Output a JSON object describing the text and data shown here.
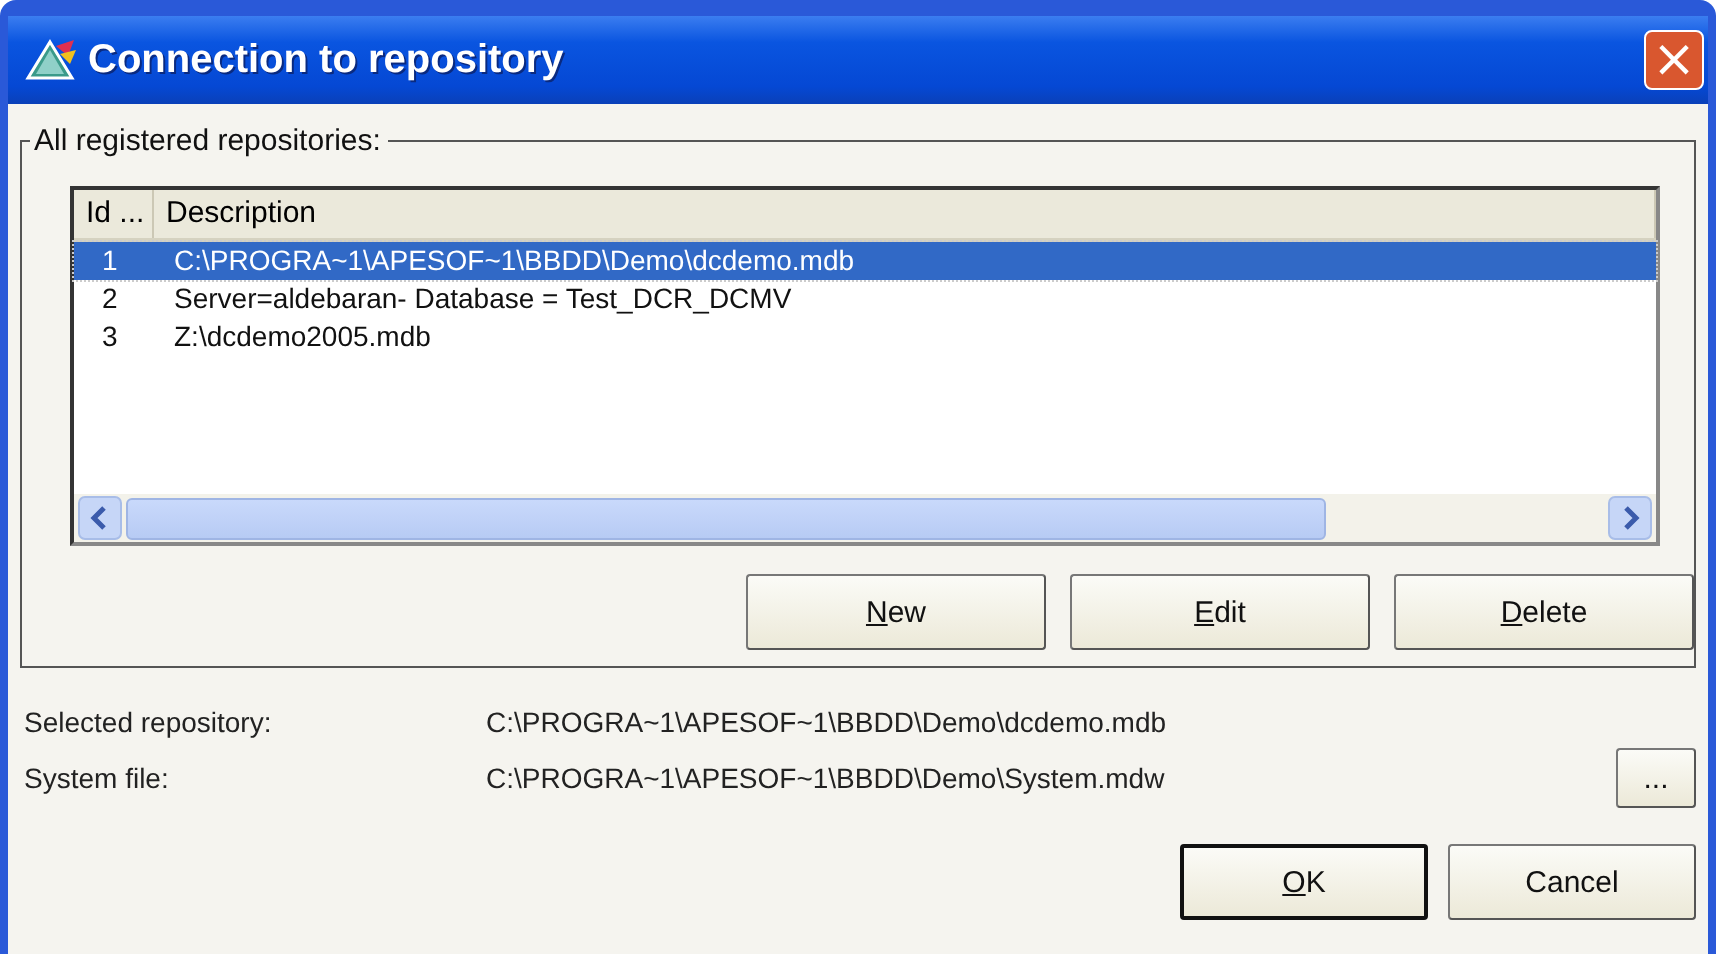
{
  "window": {
    "title": "Connection to repository",
    "close": "×"
  },
  "group": {
    "label": "All registered repositories:"
  },
  "table": {
    "columns": [
      "Id ...",
      "Description"
    ],
    "rows": [
      {
        "id": "1",
        "description": "C:\\PROGRA~1\\APESOF~1\\BBDD\\Demo\\dcdemo.mdb",
        "selected": true
      },
      {
        "id": "2",
        "description": "Server=aldebaran- Database = Test_DCR_DCMV",
        "selected": false
      },
      {
        "id": "3",
        "description": "Z:\\dcdemo2005.mdb",
        "selected": false
      }
    ]
  },
  "list_buttons": [
    {
      "label": "New",
      "mnemonic": true
    },
    {
      "label": "Edit",
      "mnemonic": true
    },
    {
      "label": "Delete",
      "mnemonic": true
    }
  ],
  "fields": [
    {
      "label": "Selected repository:",
      "value": "C:\\PROGRA~1\\APESOF~1\\BBDD\\Demo\\dcdemo.mdb"
    },
    {
      "label": "System file:",
      "value": "C:\\PROGRA~1\\APESOF~1\\BBDD\\Demo\\System.mdw",
      "browse": "..."
    }
  ],
  "dialog_buttons": [
    {
      "label": "OK",
      "mnemonic": true,
      "default": true
    },
    {
      "label": "Cancel",
      "mnemonic": false,
      "default": false
    }
  ]
}
